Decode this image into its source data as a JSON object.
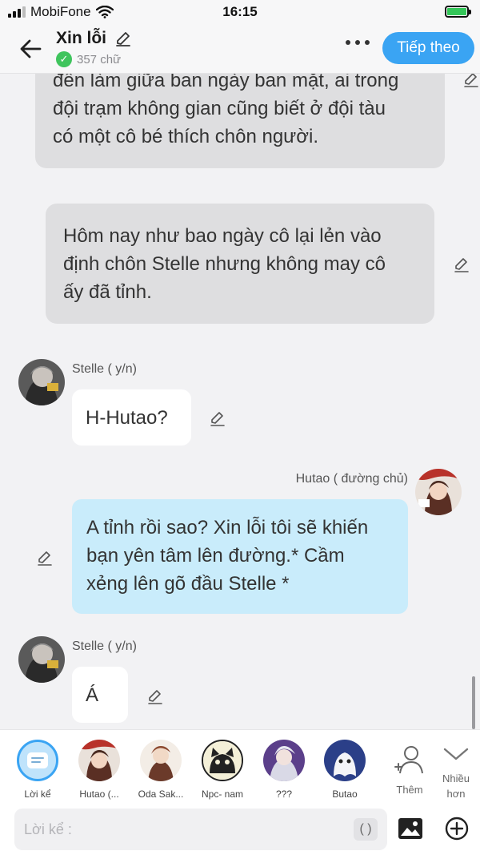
{
  "status_bar": {
    "carrier": "MobiFone",
    "time": "16:15"
  },
  "header": {
    "title": "Xin lỗi",
    "word_count": "357 chữ",
    "next_button": "Tiếp theo"
  },
  "messages": [
    {
      "type": "narration",
      "lines": [
        "đến làm giữa ban ngày ban mặt, ai trong",
        "đội trạm không gian cũng biết ở đội tàu",
        "có một cô bé thích chôn người."
      ]
    },
    {
      "type": "narration",
      "lines": [
        "Hôm nay như bao ngày cô lại lẻn vào",
        "định chôn Stelle nhưng không may cô",
        "ấy đã tỉnh."
      ]
    },
    {
      "type": "dialogue",
      "speaker": "Stelle ( y/n)",
      "lines": [
        "H-Hutao?"
      ]
    },
    {
      "type": "dialogue",
      "speaker": "Hutao ( đường chủ)",
      "lines": [
        "A tỉnh rồi sao? Xin lỗi tôi sẽ khiến",
        "bạn yên tâm lên đường.* Cầm",
        "xẻng lên gõ đầu Stelle *"
      ]
    },
    {
      "type": "dialogue",
      "speaker": "Stelle ( y/n)",
      "lines": [
        "Á"
      ]
    }
  ],
  "characters": [
    {
      "label": "Lời kể",
      "icon": "narration-icon"
    },
    {
      "label": "Hutao (...",
      "icon": "avatar-hutao"
    },
    {
      "label": "Oda Sak...",
      "icon": "avatar-oda"
    },
    {
      "label": "Npc- nam",
      "icon": "avatar-npc-cat"
    },
    {
      "label": "???",
      "icon": "avatar-unknown"
    },
    {
      "label": "Butao",
      "icon": "avatar-butao"
    }
  ],
  "side_buttons": {
    "add_label": "Thêm",
    "more_line1": "Nhiều",
    "more_line2": "hơn"
  },
  "input": {
    "placeholder": "Lời kể :",
    "paren_label": "( )"
  },
  "colors": {
    "accent": "#3aa4f3",
    "narration_bubble": "#dedee0",
    "own_bubble": "#c9ecfb",
    "check": "#3fc45d"
  }
}
